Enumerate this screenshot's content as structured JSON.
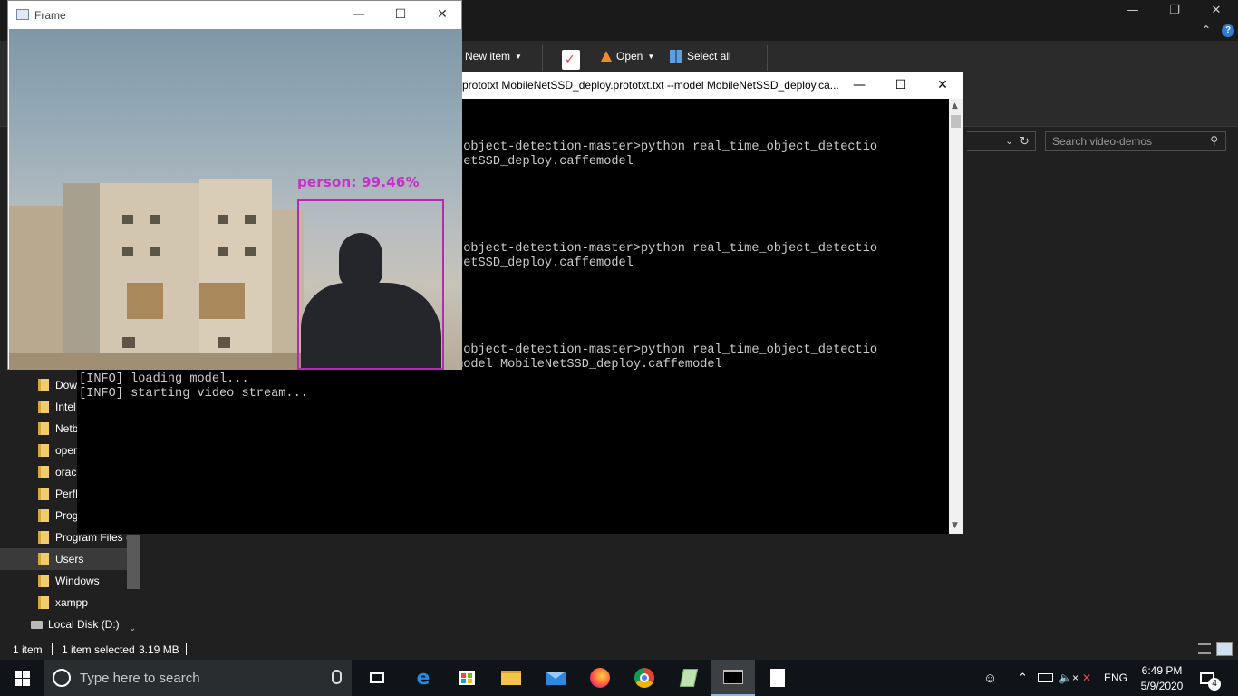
{
  "explorer": {
    "ribbon": {
      "new_item": "New item",
      "open": "Open",
      "select_all": "Select all"
    },
    "search_placeholder": "Search video-demos",
    "nav_items": [
      {
        "label": "Dow",
        "icon": "folder-icon"
      },
      {
        "label": "Intel",
        "icon": "folder-icon"
      },
      {
        "label": "Netb",
        "icon": "folder-icon"
      },
      {
        "label": "oper",
        "icon": "folder-icon"
      },
      {
        "label": "oracl",
        "icon": "folder-icon"
      },
      {
        "label": "PerfL",
        "icon": "folder-icon"
      },
      {
        "label": "Prog",
        "icon": "folder-icon"
      },
      {
        "label": "Program Files (",
        "icon": "folder-icon"
      },
      {
        "label": "Users",
        "icon": "folder-icon",
        "selected": true
      },
      {
        "label": "Windows",
        "icon": "folder-icon"
      },
      {
        "label": "xampp",
        "icon": "folder-icon"
      },
      {
        "label": "Local Disk (D:)",
        "icon": "drive-icon"
      }
    ],
    "status": {
      "items": "1 item",
      "selected": "1 item selected",
      "size": "3.19 MB"
    }
  },
  "console": {
    "title": "prototxt MobileNetSSD_deploy.prototxt.txt --model MobileNetSSD_deploy.ca...",
    "lines": [
      "",
      "",
      "",
      "                                         r\\realtime-object-detection-master>python real_time_object_detectio",
      "                                         del MobileNetSSD_deploy.caffemodel",
      "",
      "",
      "",
      "",
      "",
      "                                         r\\realtime-object-detection-master>python real_time_object_detectio",
      "                                         del MobileNetSSD_deploy.caffemodel",
      "",
      "",
      "",
      "",
      "",
      "                                         r\\realtime-object-detection-master>python real_time_object_detectio",
      "n.py --prototxt MobileNetSSD_deploy.prototxt.txt --model MobileNetSSD_deploy.caffemodel",
      "[INFO] loading model...",
      "[INFO] starting video stream..."
    ]
  },
  "frame": {
    "title": "Frame",
    "detection": {
      "label": "person: 99.46%",
      "class": "person",
      "confidence": 99.46,
      "color": "#b42ab4"
    }
  },
  "taskbar": {
    "search_placeholder": "Type here to search",
    "apps": [
      "task-view-icon",
      "edge-icon",
      "store-icon",
      "file-explorer-icon",
      "mail-icon",
      "firefox-icon",
      "chrome-icon",
      "notepadpp-icon",
      "command-prompt-icon",
      "document-icon"
    ],
    "language": "ENG",
    "time": "6:49 PM",
    "date": "5/9/2020",
    "notification_count": "4"
  },
  "colors": {
    "accent": "#8db3e2",
    "detection": "#b42ab4"
  }
}
